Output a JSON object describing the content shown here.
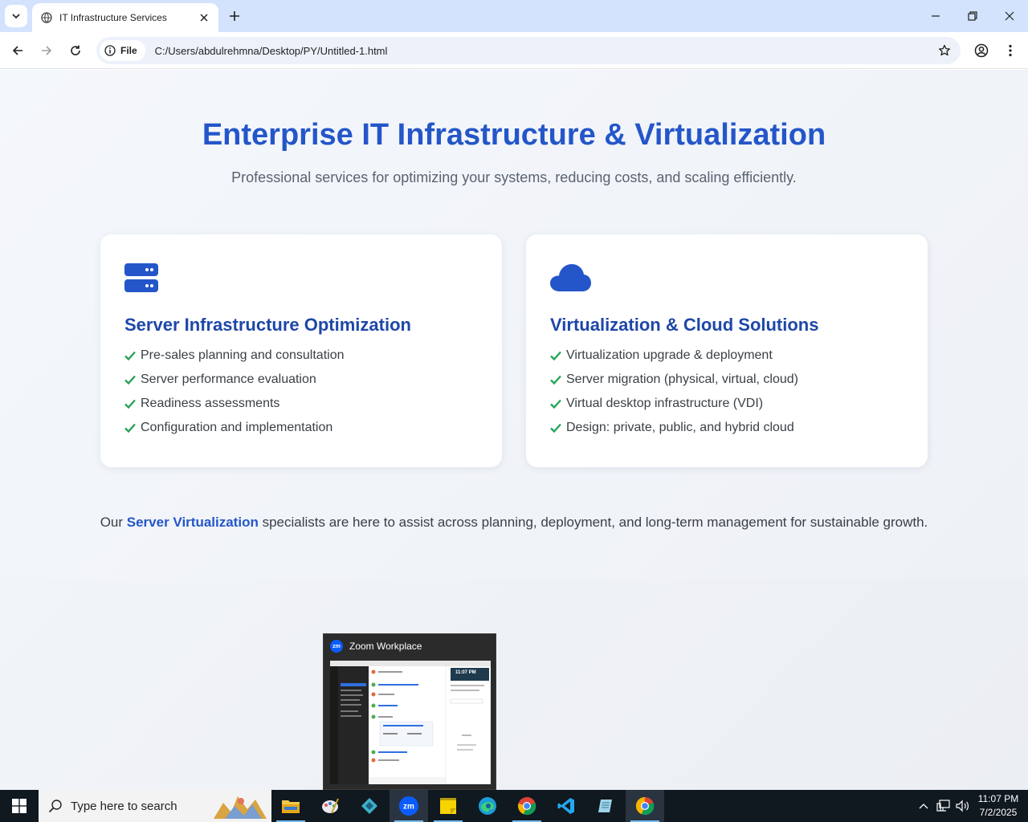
{
  "browser": {
    "tab_title": "IT Infrastructure Services",
    "site_chip": "File",
    "url": "C:/Users/abdulrehmna/Desktop/PY/Untitled-1.html"
  },
  "hero": {
    "title": "Enterprise IT Infrastructure & Virtualization",
    "subtitle": "Professional services for optimizing your systems, reducing costs, and scaling efficiently."
  },
  "cards": [
    {
      "icon": "server-icon",
      "title": "Server Infrastructure Optimization",
      "items": [
        "Pre-sales planning and consultation",
        "Server performance evaluation",
        "Readiness assessments",
        "Configuration and implementation"
      ]
    },
    {
      "icon": "cloud-icon",
      "title": "Virtualization & Cloud Solutions",
      "items": [
        "Virtualization upgrade & deployment",
        "Server migration (physical, virtual, cloud)",
        "Virtual desktop infrastructure (VDI)",
        "Design: private, public, and hybrid cloud"
      ]
    }
  ],
  "footer": {
    "before": "Our ",
    "highlight": "Server Virtualization",
    "after": " specialists are here to assist across planning, deployment, and long-term management for sustainable growth."
  },
  "zoom_preview": {
    "title": "Zoom Workplace",
    "logo_text": "zm",
    "clock": "11:07 PM"
  },
  "taskbar": {
    "search_placeholder": "Type here to search",
    "time": "11:07 PM",
    "date": "7/2/2025",
    "apps": [
      "file-explorer",
      "paint-app",
      "app-diamond",
      "zoom",
      "sticky-notes",
      "edge",
      "chrome",
      "vscode",
      "notepad",
      "chrome-active"
    ]
  },
  "colors": {
    "accent": "#2456c9",
    "card_title": "#1e47a8",
    "check": "#2aa35a",
    "tabstrip": "#d3e3fd"
  }
}
